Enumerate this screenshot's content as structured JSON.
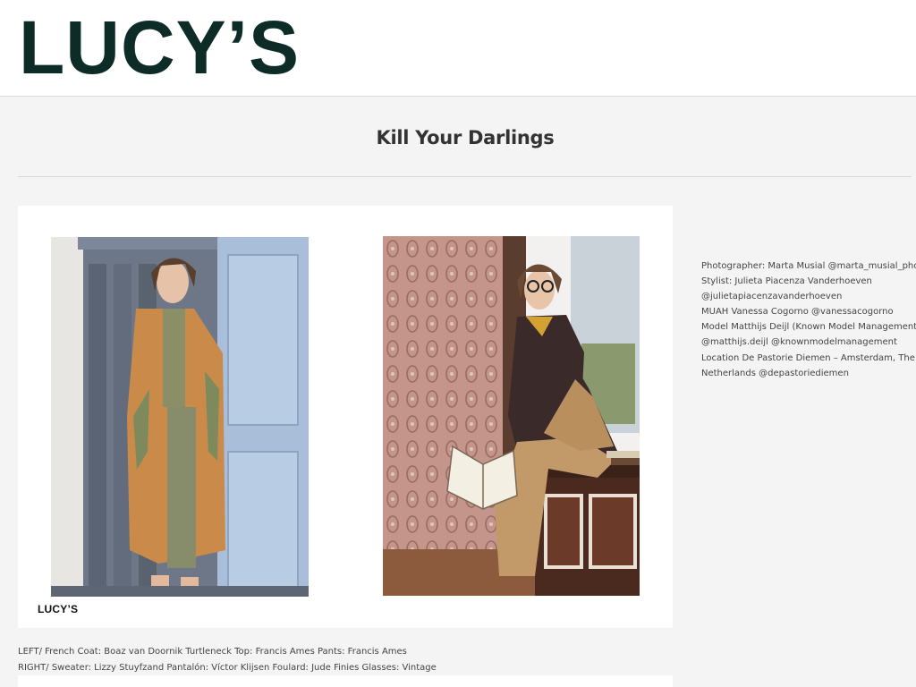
{
  "header": {
    "logo_text": "LUCY’S"
  },
  "page": {
    "title": "Kill Your Darlings"
  },
  "photo_card": {
    "brand_label": "LUCY’S",
    "left_photo_alt": "Model in tan trench coat standing in blue doorway",
    "right_photo_alt": "Model with glasses reading a book by a window"
  },
  "credits": {
    "lines": [
      "Photographer: Marta Musial @marta_musial_photo",
      "Stylist: Julieta Piacenza Vanderhoeven",
      "@julietapiacenzavanderhoeven",
      "MUAH Vanessa Cogorno @vanessacogorno",
      "Model Matthijs Deijl (Known Model Management)",
      "@matthijs.deijl @knownmodelmanagement",
      "Location De Pastorie Diemen – Amsterdam, The",
      "Netherlands @depastoriediemen"
    ]
  },
  "caption": {
    "left": "LEFT/ French Coat: Boaz van Doornik Turtleneck Top: Francis Ames Pants: Francis Ames",
    "right": "RIGHT/ Sweater: Lizzy Stuyfzand Pantalón: Víctor Klijsen Foulard: Jude Finies Glasses: Vintage"
  },
  "colors": {
    "logo": "#0d2b27",
    "background": "#f4f4f4",
    "card": "#ffffff"
  }
}
